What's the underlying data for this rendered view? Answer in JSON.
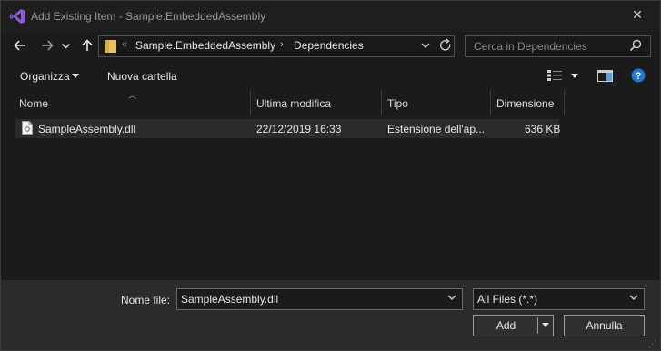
{
  "window": {
    "title": "Add Existing Item - Sample.EmbeddedAssembly",
    "close_glyph": "✕"
  },
  "nav": {
    "back_icon": "arrow-left-icon",
    "forward_icon": "arrow-right-icon",
    "recent_icon": "chevron-down-icon",
    "up_icon": "arrow-up-icon",
    "crumb_overflow": "«",
    "crumbs": [
      "Sample.EmbeddedAssembly",
      "Dependencies"
    ],
    "crumb_sep": "›",
    "search_placeholder": "Cerca in Dependencies"
  },
  "toolbar": {
    "organize": "Organizza",
    "new_folder": "Nuova cartella"
  },
  "columns": [
    "Nome",
    "Ultima modifica",
    "Tipo",
    "Dimensione"
  ],
  "files": [
    {
      "name": "SampleAssembly.dll",
      "modified": "22/12/2019 16:33",
      "type": "Estensione dell'ap...",
      "size": "636 KB"
    }
  ],
  "footer": {
    "file_name_label": "Nome file:",
    "file_name_value": "SampleAssembly.dll",
    "file_type_value": "All Files (*.*)",
    "add_label": "Add",
    "cancel_label": "Annulla"
  },
  "colors": {
    "background": "#1b1b1b",
    "accent_blue": "#1e78d4",
    "vs_purple": "#8e5bd6",
    "folder_yellow": "#e8c361"
  }
}
